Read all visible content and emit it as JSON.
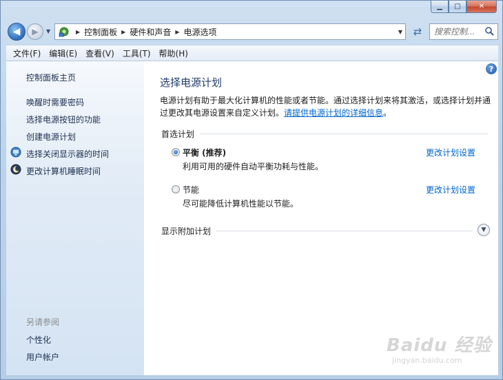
{
  "window": {
    "minimize": "▁",
    "maximize": "□",
    "close": "✕"
  },
  "address": {
    "crumbs": [
      "控制面板",
      "硬件和声音",
      "电源选项"
    ]
  },
  "search": {
    "placeholder": "搜索控制..."
  },
  "menu": [
    "文件(F)",
    "编辑(E)",
    "查看(V)",
    "工具(T)",
    "帮助(H)"
  ],
  "sidebar": {
    "home": "控制面板主页",
    "links": [
      {
        "label": "唤醒时需要密码"
      },
      {
        "label": "选择电源按钮的功能"
      },
      {
        "label": "创建电源计划"
      },
      {
        "label": "选择关闭显示器的时间",
        "icon": "monitor-icon"
      },
      {
        "label": "更改计算机睡眠时间",
        "icon": "moon-icon"
      }
    ],
    "see_also_title": "另请参阅",
    "see_also": [
      "个性化",
      "用户帐户"
    ]
  },
  "main": {
    "title": "选择电源计划",
    "desc_line1": "电源计划有助于最大化计算机的性能或者节能。通过选择计划来将其激活，或选择计划并通",
    "desc_line2_prefix": "过更改其电源设置来自定义计划。",
    "desc_link": "请提供电源计划的详细信息",
    "desc_suffix": "。",
    "preferred_title": "首选计划",
    "plans": [
      {
        "name": "平衡 (推荐)",
        "desc": "利用可用的硬件自动平衡功耗与性能。",
        "link": "更改计划设置",
        "selected": true
      },
      {
        "name": "节能",
        "desc": "尽可能降低计算机性能以节能。",
        "link": "更改计划设置",
        "selected": false
      }
    ],
    "additional_title": "显示附加计划"
  },
  "watermark": {
    "brand": "Baidu 经验",
    "url": "jingyan.baidu.com"
  },
  "colors": {
    "accent": "#1e3a6b",
    "link": "#0066cc",
    "sidebar_top": "#f6f9fd",
    "sidebar_bottom": "#d4e3f3"
  }
}
